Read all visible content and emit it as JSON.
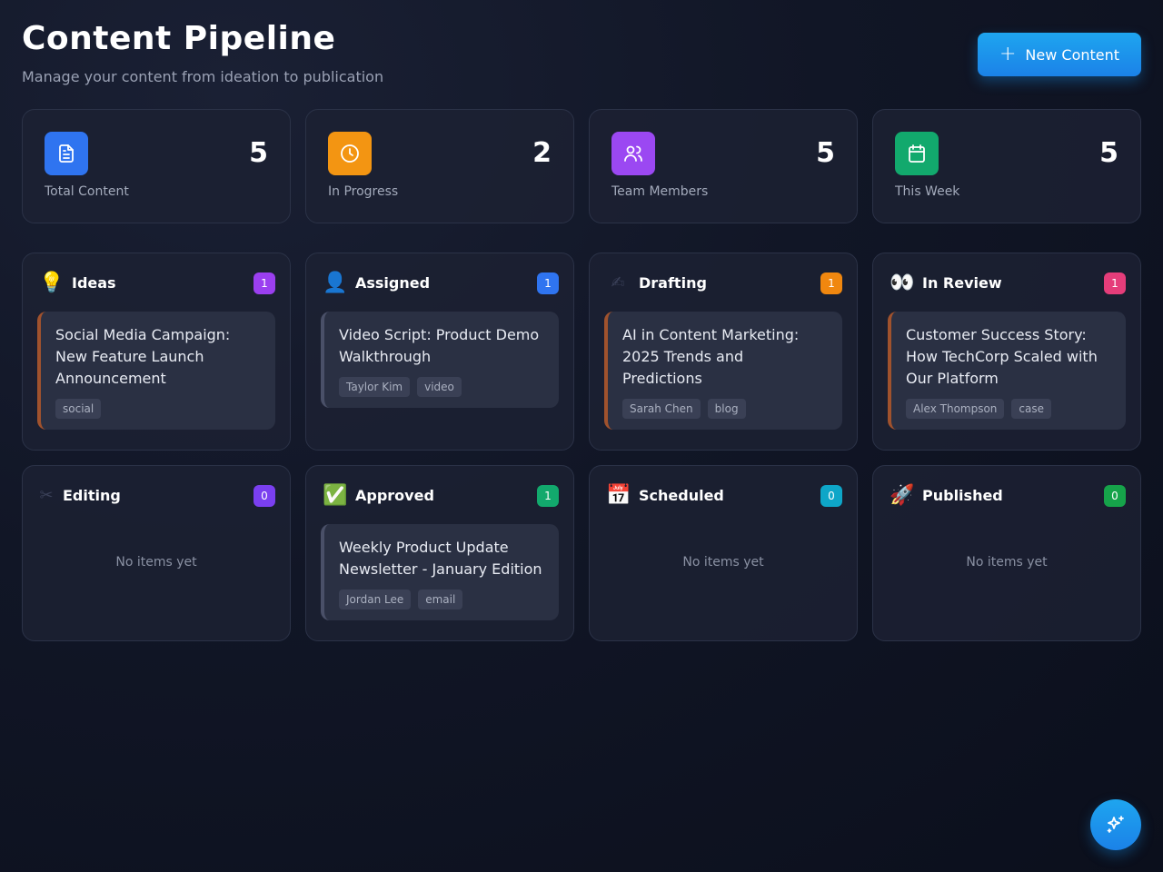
{
  "header": {
    "title": "Content Pipeline",
    "subtitle": "Manage your content from ideation to publication",
    "new_button_label": "New Content"
  },
  "stats": [
    {
      "label": "Total Content",
      "value": "5",
      "icon": "document-icon",
      "color": "#2f74f0"
    },
    {
      "label": "In Progress",
      "value": "2",
      "icon": "clock-icon",
      "color": "#f39512"
    },
    {
      "label": "Team Members",
      "value": "5",
      "icon": "users-icon",
      "color": "#9b48f2"
    },
    {
      "label": "This Week",
      "value": "5",
      "icon": "calendar-icon",
      "color": "#12a96d"
    }
  ],
  "columns": [
    {
      "key": "ideas",
      "title": "Ideas",
      "emoji": "💡",
      "count": "1",
      "color": "#9b3ff0",
      "cards": [
        {
          "title": "Social Media Campaign: New Feature Launch Announcement",
          "tags": [
            "social"
          ],
          "accent": true
        }
      ]
    },
    {
      "key": "assigned",
      "title": "Assigned",
      "emoji": "👤",
      "count": "1",
      "color": "#2f74f0",
      "cards": [
        {
          "title": "Video Script: Product Demo Walkthrough",
          "tags": [
            "Taylor Kim",
            "video"
          ],
          "accent": false
        }
      ]
    },
    {
      "key": "drafting",
      "title": "Drafting",
      "emoji": "✍",
      "count": "1",
      "color": "#f0870f",
      "cards": [
        {
          "title": "AI in Content Marketing: 2025 Trends and Predictions",
          "tags": [
            "Sarah Chen",
            "blog"
          ],
          "accent": true
        }
      ]
    },
    {
      "key": "in-review",
      "title": "In Review",
      "emoji": "👀",
      "count": "1",
      "color": "#e53d7a",
      "cards": [
        {
          "title": "Customer Success Story: How TechCorp Scaled with Our Platform",
          "tags": [
            "Alex Thompson",
            "case"
          ],
          "accent": true
        }
      ]
    },
    {
      "key": "editing",
      "title": "Editing",
      "emoji": "✂",
      "count": "0",
      "color": "#7a3ff0",
      "cards": [],
      "empty": "No items yet"
    },
    {
      "key": "approved",
      "title": "Approved",
      "emoji": "✅",
      "count": "1",
      "color": "#12a96d",
      "cards": [
        {
          "title": "Weekly Product Update Newsletter - January Edition",
          "tags": [
            "Jordan Lee",
            "email"
          ],
          "accent": false
        }
      ]
    },
    {
      "key": "scheduled",
      "title": "Scheduled",
      "emoji": "📅",
      "count": "0",
      "color": "#0ea6c8",
      "cards": [],
      "empty": "No items yet"
    },
    {
      "key": "published",
      "title": "Published",
      "emoji": "🚀",
      "count": "0",
      "color": "#16a34a",
      "cards": [],
      "empty": "No items yet"
    }
  ],
  "fab": {
    "icon": "sparkles-icon"
  }
}
